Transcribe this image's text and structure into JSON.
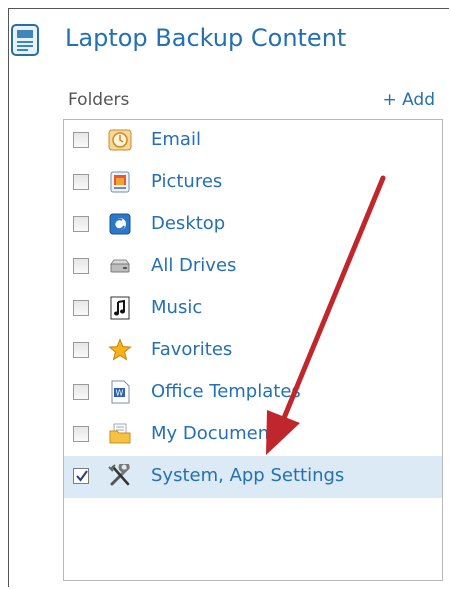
{
  "header": {
    "title": "Laptop Backup Content",
    "icon": "document-icon"
  },
  "folders": {
    "label": "Folders",
    "add_label": "+ Add"
  },
  "colors": {
    "link": "#2470b3",
    "selected_row": "#dbeaf4",
    "arrow": "#c0272d"
  },
  "items": [
    {
      "label": "Email",
      "checked": false,
      "icon": "email-clock-icon"
    },
    {
      "label": "Pictures",
      "checked": false,
      "icon": "pictures-icon"
    },
    {
      "label": "Desktop",
      "checked": false,
      "icon": "desktop-icon"
    },
    {
      "label": "All Drives",
      "checked": false,
      "icon": "drive-icon"
    },
    {
      "label": "Music",
      "checked": false,
      "icon": "music-note-icon"
    },
    {
      "label": "Favorites",
      "checked": false,
      "icon": "star-icon"
    },
    {
      "label": "Office Templates",
      "checked": false,
      "icon": "word-document-icon"
    },
    {
      "label": "My Documents",
      "checked": false,
      "icon": "folder-documents-icon"
    },
    {
      "label": "System, App Settings",
      "checked": true,
      "icon": "tools-icon"
    }
  ]
}
